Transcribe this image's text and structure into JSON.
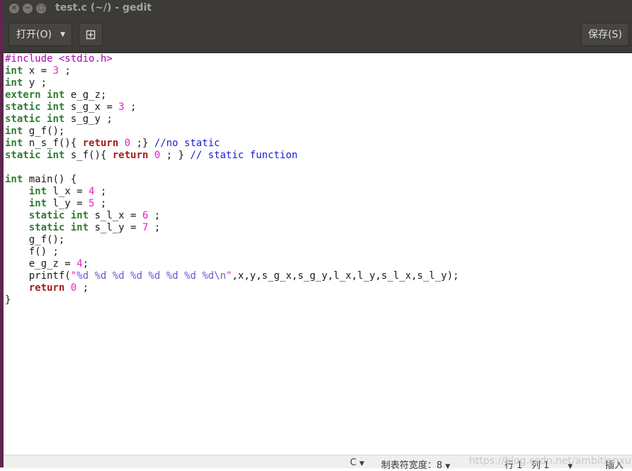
{
  "window": {
    "title": "test.c (~/) - gedit",
    "controls": {
      "close": "×",
      "minimize": "−",
      "maximize": "□"
    }
  },
  "toolbar": {
    "open_label": "打开(O)",
    "new_tab_icon": "new-document-icon",
    "save_label": "保存(S)"
  },
  "editor": {
    "language": "c",
    "lines": [
      "#include <stdio.h>",
      "int x = 3 ;",
      "int y ;",
      "extern int e_g_z;",
      "static int s_g_x = 3 ;",
      "static int s_g_y ;",
      "int g_f();",
      "int n_s_f(){ return 0 ;} //no static",
      "static int s_f(){ return 0 ; } // static function",
      "",
      "int main() {",
      "    int l_x = 4 ;",
      "    int l_y = 5 ;",
      "    static int s_l_x = 6 ;",
      "    static int s_l_y = 7 ;",
      "    g_f();",
      "    f() ;",
      "    e_g_z = 4;",
      "    printf(\"%d %d %d %d %d %d %d %d\\n\",x,y,s_g_x,s_g_y,l_x,l_y,s_l_x,s_l_y);",
      "    return 0 ;",
      "}"
    ]
  },
  "statusbar": {
    "language": "C",
    "tab_width_label": "制表符宽度：",
    "tab_width_value": "8",
    "line_label": "行 1",
    "col_label": "列 1",
    "insert_mode": "插入"
  },
  "watermark": "https://blog.csdn.net/ambitionxu",
  "colors": {
    "titlebar": "#3c3b37",
    "left_strip": "#5e2750",
    "keyword_type": "#2e7d32",
    "keyword_control": "#a61d1d",
    "number_string": "#e820c8",
    "comment": "#1b20d6",
    "preprocessor": "#b000b0"
  }
}
